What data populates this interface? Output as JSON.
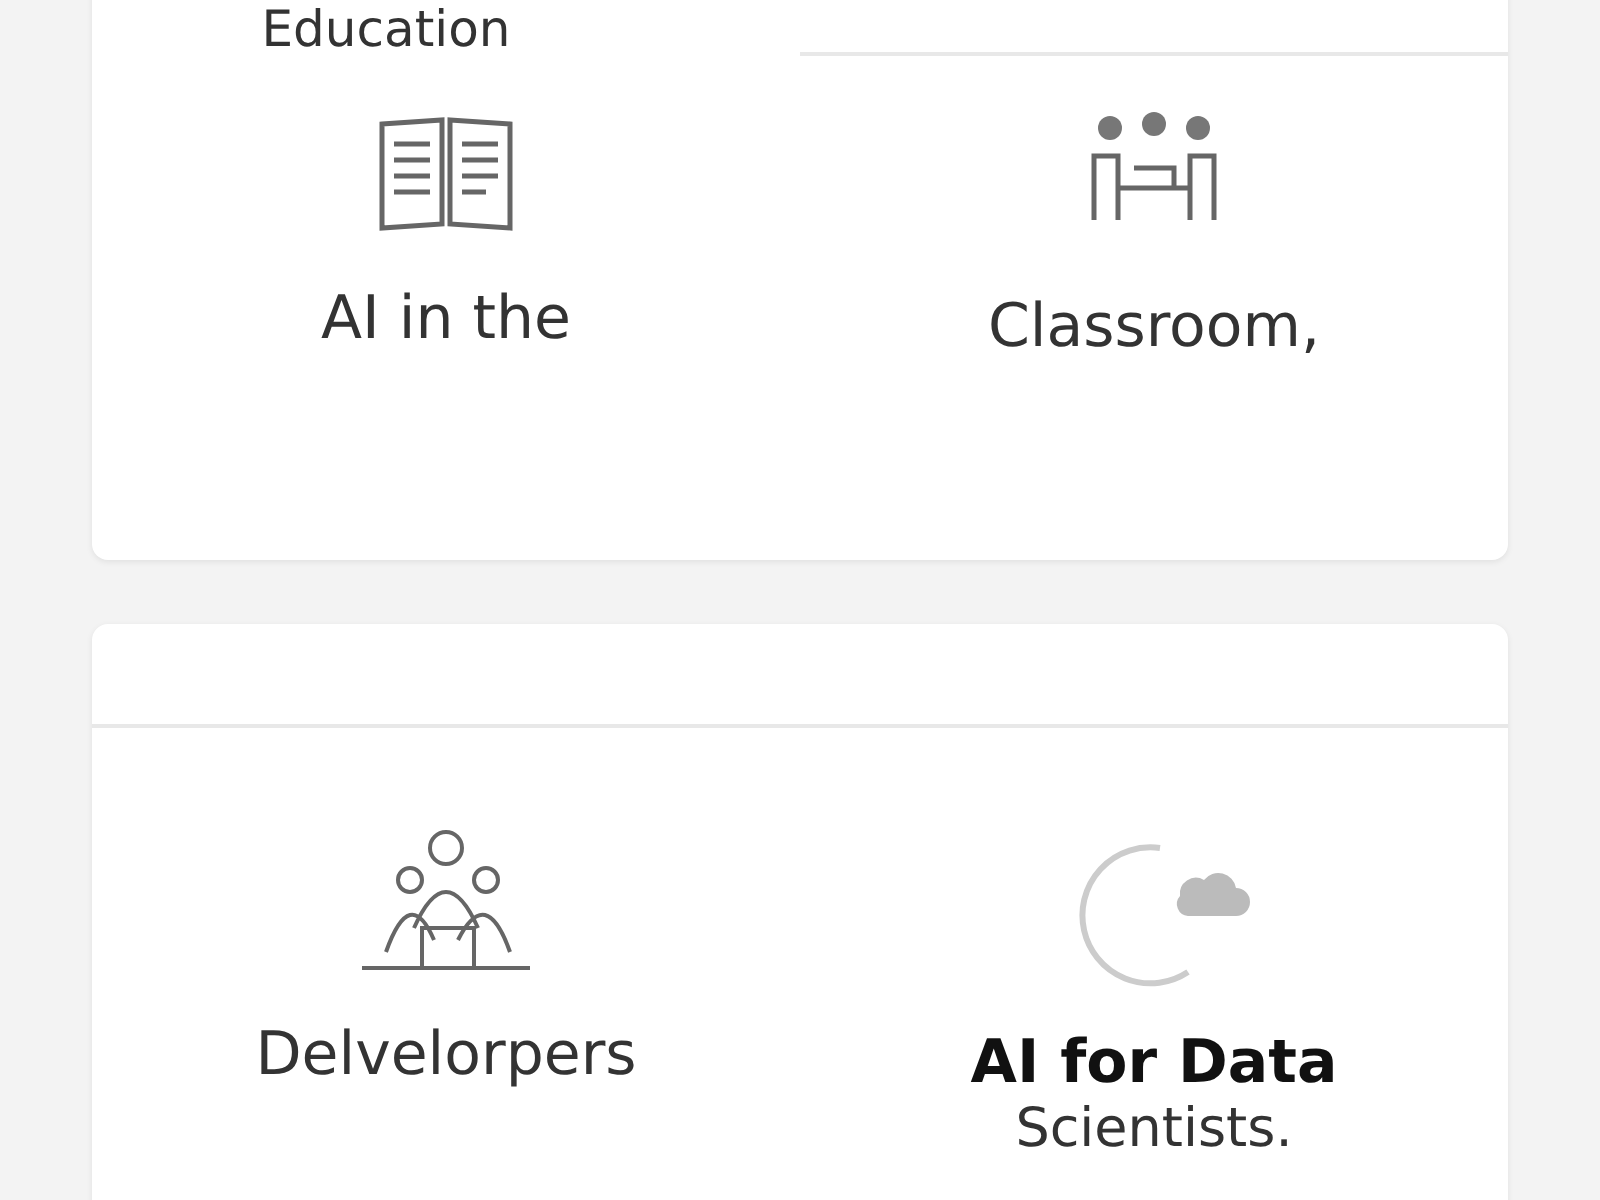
{
  "cards": [
    {
      "title": "Education",
      "items": [
        {
          "kind": "book",
          "label": "AI in the",
          "bold": false
        },
        {
          "kind": "meeting",
          "label": "Classroom,",
          "bold": false
        }
      ]
    },
    {
      "items": [
        {
          "kind": "group",
          "label": "Delvelorpers",
          "bold": false
        },
        {
          "kind": "cloud",
          "label": "AI for Data",
          "bold": true,
          "sub": "Scientists."
        }
      ]
    }
  ]
}
